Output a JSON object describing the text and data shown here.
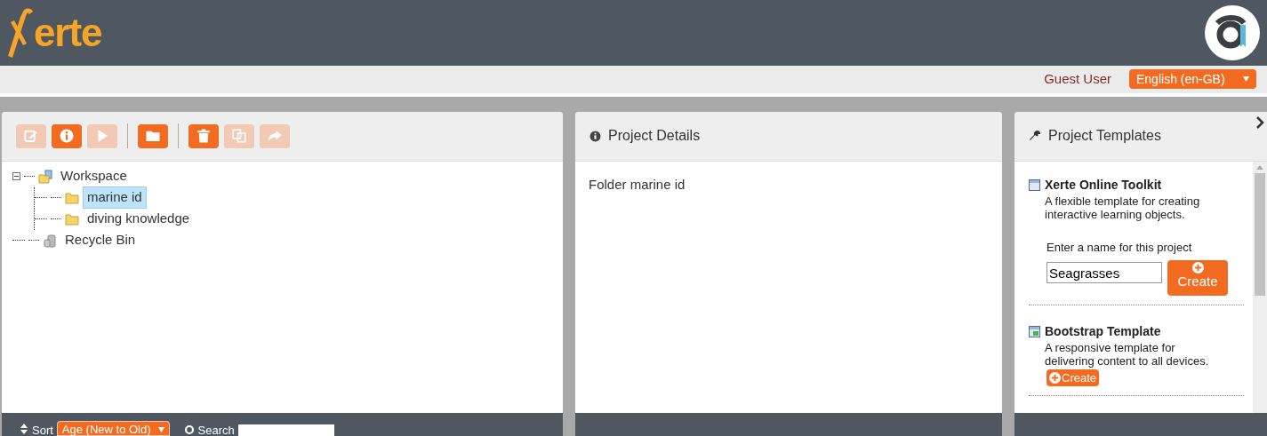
{
  "header": {
    "logo": "erte",
    "user": "Guest User",
    "language": "English (en-GB)"
  },
  "toolbar": [
    {
      "kind": "edit",
      "disabled": true
    },
    {
      "kind": "info",
      "disabled": false
    },
    {
      "kind": "play",
      "disabled": true
    },
    {
      "kind": "separator"
    },
    {
      "kind": "folder",
      "disabled": false
    },
    {
      "kind": "separator"
    },
    {
      "kind": "delete",
      "disabled": false
    },
    {
      "kind": "duplicate",
      "disabled": true
    },
    {
      "kind": "publish",
      "disabled": true
    }
  ],
  "tree": [
    {
      "label": "Workspace",
      "kind": "workspace",
      "selected": false,
      "expanded": true,
      "children": [
        {
          "label": "marine id",
          "kind": "folder",
          "selected": true
        },
        {
          "label": "diving knowledge",
          "kind": "folder",
          "selected": false
        }
      ]
    },
    {
      "label": "Recycle Bin",
      "kind": "bin",
      "selected": false
    }
  ],
  "footer": {
    "sort_label": "Sort",
    "sort_value": "Age (New to Old)",
    "search_label": "Search"
  },
  "details": {
    "title": "Project Details",
    "text": "Folder marine id"
  },
  "templates": {
    "title": "Project Templates",
    "items": [
      {
        "name": "Xerte Online Toolkit",
        "description": "A flexible template for creating interactive learning objects.",
        "name_label": "Enter a name for this project",
        "name_value": "Seagrasses",
        "button": "Create",
        "kind": "form"
      },
      {
        "name": "Bootstrap Template",
        "description": "A responsive template for delivering content to all devices.",
        "button": "Create",
        "kind": "compact"
      }
    ]
  }
}
